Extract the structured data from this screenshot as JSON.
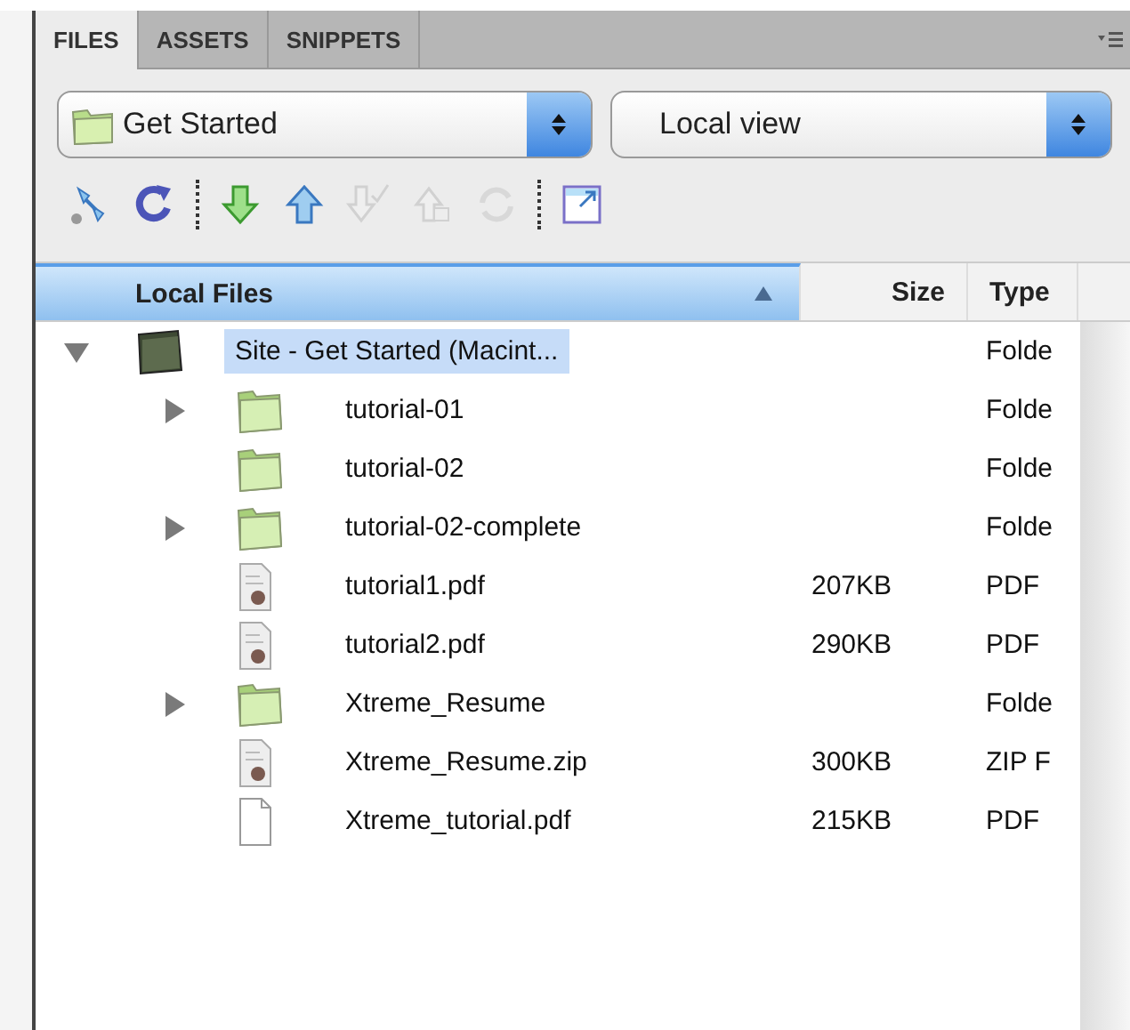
{
  "tabs": [
    {
      "label": "FILES",
      "selected": true
    },
    {
      "label": "ASSETS",
      "selected": false
    },
    {
      "label": "SNIPPETS",
      "selected": false
    }
  ],
  "site_select": {
    "value": "Get Started"
  },
  "view_select": {
    "value": "Local view"
  },
  "toolbar": [
    {
      "kind": "connect",
      "disabled": false
    },
    {
      "kind": "refresh",
      "disabled": false
    },
    {
      "kind": "separator"
    },
    {
      "kind": "get",
      "disabled": false
    },
    {
      "kind": "put",
      "disabled": false
    },
    {
      "kind": "checkout",
      "disabled": true
    },
    {
      "kind": "checkin",
      "disabled": true
    },
    {
      "kind": "sync",
      "disabled": true
    },
    {
      "kind": "separator"
    },
    {
      "kind": "expand",
      "disabled": false
    }
  ],
  "columns": [
    {
      "label": "Local Files",
      "sorted": true
    },
    {
      "label": "Size",
      "sorted": false
    },
    {
      "label": "Type",
      "sorted": false
    }
  ],
  "tree": [
    {
      "kind": "site",
      "name": "Site - Get Started (Macint...",
      "type": "Folde",
      "expanded": true,
      "selected": true,
      "children": [
        {
          "kind": "folder",
          "name": "tutorial-01",
          "type": "Folde",
          "expanded": false,
          "selected": false
        },
        {
          "kind": "folder",
          "name": "tutorial-02",
          "type": "Folde",
          "selected": false
        },
        {
          "kind": "folder",
          "name": "tutorial-02-complete",
          "type": "Folde",
          "expanded": false,
          "selected": false
        },
        {
          "kind": "document",
          "name": "tutorial1.pdf",
          "size": "207KB",
          "type": "PDF",
          "selected": false
        },
        {
          "kind": "document",
          "name": "tutorial2.pdf",
          "size": "290KB",
          "type": "PDF",
          "selected": false
        },
        {
          "kind": "folder",
          "name": "Xtreme_Resume",
          "type": "Folde",
          "expanded": false,
          "selected": false
        },
        {
          "kind": "document",
          "name": "Xtreme_Resume.zip",
          "size": "300KB",
          "type": "ZIP F",
          "selected": false
        },
        {
          "kind": "blank",
          "name": "Xtreme_tutorial.pdf",
          "size": "215KB",
          "type": "PDF",
          "selected": false
        }
      ]
    }
  ]
}
